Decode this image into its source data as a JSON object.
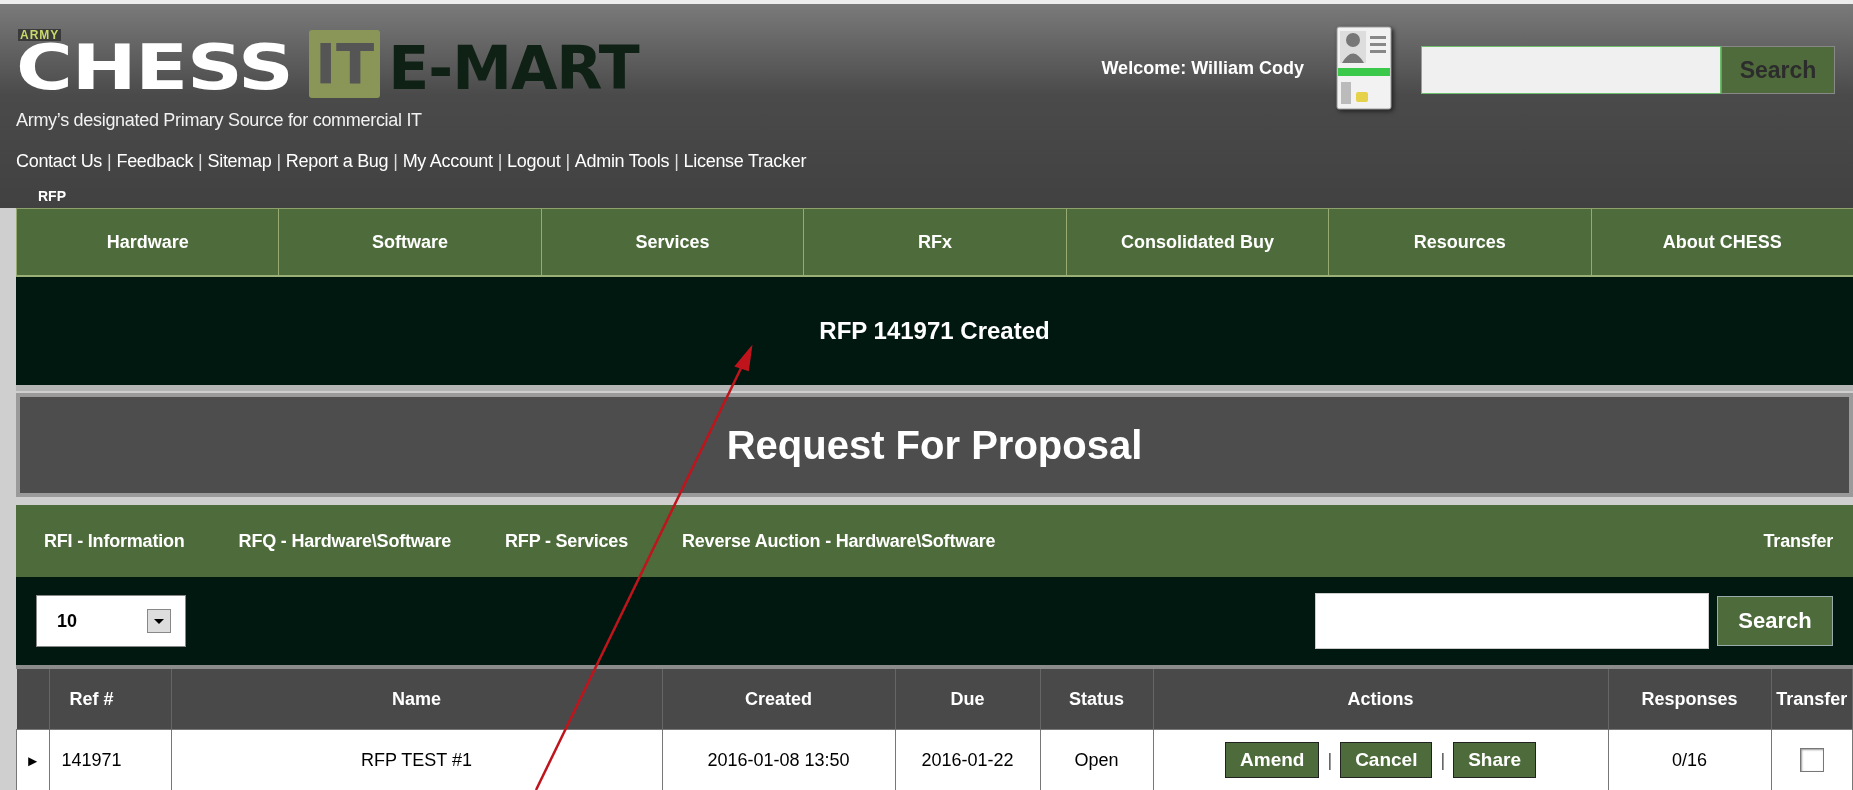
{
  "header": {
    "logo": {
      "badge": "ARMY",
      "word_1": "CHESS",
      "box": "IT",
      "word_2": "E-MART"
    },
    "tagline": "Army’s designated Primary Source for commercial IT",
    "links": [
      "Contact Us",
      "Feedback",
      "Sitemap",
      "Report a Bug",
      "My Account",
      "Logout",
      "Admin Tools",
      "License Tracker"
    ],
    "link_separator": "|",
    "breadcrumb": "RFP",
    "welcome": "Welcome: William Cody",
    "search": {
      "button": "Search"
    }
  },
  "nav": {
    "items": [
      "Hardware",
      "Software",
      "Services",
      "RFx",
      "Consolidated Buy",
      "Resources",
      "About CHESS"
    ]
  },
  "banner": {
    "message": "RFP 141971 Created"
  },
  "page_title": "Request For Proposal",
  "subnav": {
    "tabs": [
      "RFI - Information",
      "RFQ - Hardware\\Software",
      "RFP - Services",
      "Reverse Auction - Hardware\\Software"
    ],
    "right_link": "Transfer"
  },
  "toolbar": {
    "page_size": "10",
    "search": {
      "button": "Search"
    }
  },
  "table": {
    "columns": [
      "Ref #",
      "Name",
      "Created",
      "Due",
      "Status",
      "Actions",
      "Responses",
      "Transfer"
    ],
    "rows": [
      {
        "expander": "►",
        "ref": "141971",
        "name": "RFP TEST #1",
        "created": "2016-01-08 13:50",
        "due": "2016-01-22",
        "status": "Open",
        "actions": [
          "Amend",
          "Cancel",
          "Share"
        ],
        "action_separator": "|",
        "responses": "0/16",
        "transfer_checked": false
      }
    ]
  }
}
